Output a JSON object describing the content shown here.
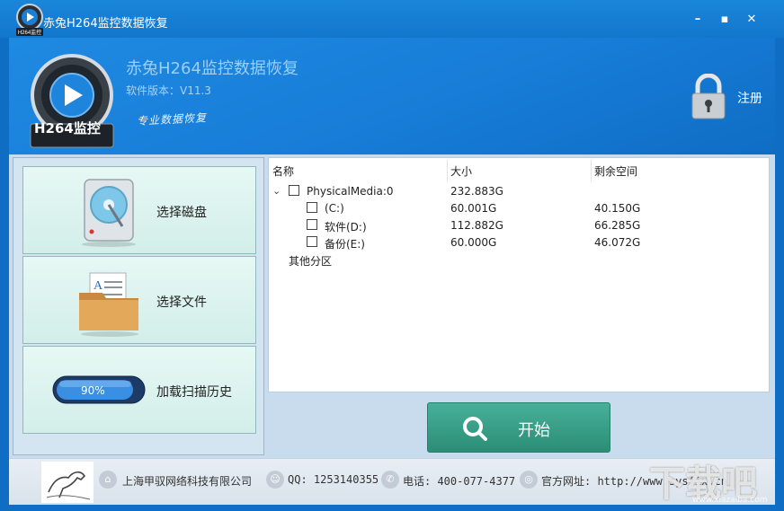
{
  "window": {
    "title": "赤兔H264监控数据恢复",
    "minimize_icon": "minimize-icon",
    "maximize_icon": "maximize-icon",
    "close_icon": "close-icon"
  },
  "header": {
    "logo_label": "H264监控",
    "app_name": "赤兔H264监控数据恢复",
    "version": "软件版本：V11.3",
    "slogan": "专业数据恢复",
    "register_label": "注册"
  },
  "actions": [
    {
      "label": "选择磁盘",
      "icon": "disk-icon"
    },
    {
      "label": "选择文件",
      "icon": "folder-icon"
    },
    {
      "label": "加载扫描历史",
      "icon": "progress-icon",
      "progress_text": "90%",
      "progress_fraction": 0.9
    }
  ],
  "tree": {
    "columns": [
      "名称",
      "大小",
      "剩余空间"
    ],
    "root": {
      "name": "PhysicalMedia:0",
      "size": "232.883G",
      "free": ""
    },
    "partitions": [
      {
        "name": "(C:)",
        "size": "60.001G",
        "free": "40.150G"
      },
      {
        "name": "软件(D:)",
        "size": "112.882G",
        "free": "66.285G"
      },
      {
        "name": "备份(E:)",
        "size": "60.000G",
        "free": "46.072G"
      }
    ],
    "other": "其他分区"
  },
  "start_button": {
    "label": "开始",
    "icon": "search-icon"
  },
  "footer": {
    "company": "上海甲驭网络科技有限公司",
    "qq": "QQ: 1253140355",
    "phone": "电话: 400-077-4377",
    "website": "官方网址: http://www.sysfix.cn"
  },
  "watermark": {
    "text": "下载吧",
    "sub": "www.xiazaiba.com"
  },
  "colors": {
    "title_bar": "#1a86da",
    "accent": "#2c8d75",
    "header": "#177dd8"
  }
}
